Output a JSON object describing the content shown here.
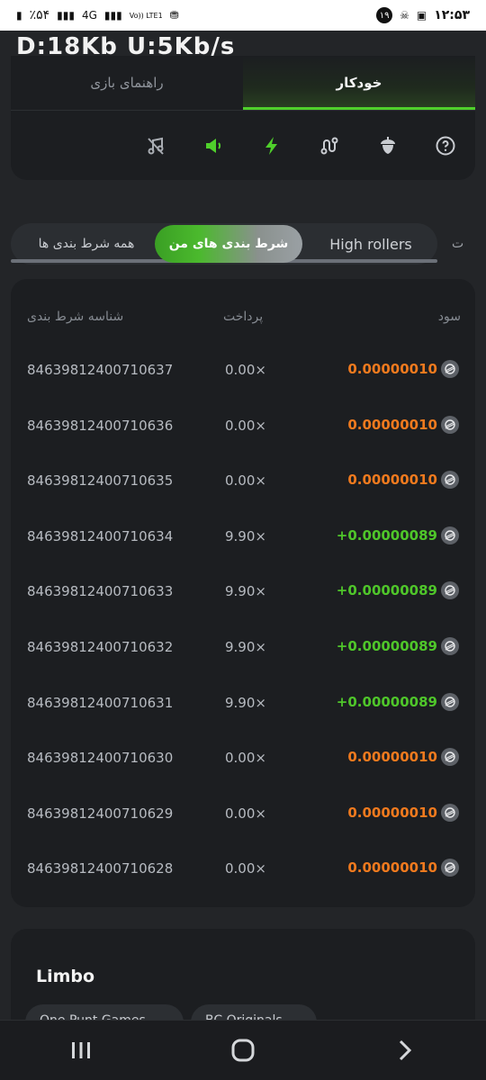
{
  "status_bar": {
    "battery": "٪۵۴",
    "network": "4G",
    "volte": "Vo)) LTE1",
    "notification_count": "۱۹",
    "time": "۱۲:۵۳"
  },
  "top_overlay_text": "D:18Kb  U:5Kb/s",
  "mode_tabs": {
    "guide_label": "راهنمای بازی",
    "auto_label": "خودکار"
  },
  "tool_icons": [
    "music-off-icon",
    "sound-icon",
    "lightning-icon",
    "route-icon",
    "acorn-icon",
    "help-icon"
  ],
  "accent_color": "#4fd02b",
  "bet_tabs": {
    "all_bets": "همه شرط بندی ها",
    "my_bets": "شرط بندی های من",
    "high_rollers": "High rollers",
    "cut_tab": "ت"
  },
  "table": {
    "headers": {
      "id": "شناسه شرط بندی",
      "payout": "پرداخت",
      "profit": "سود"
    },
    "rows": [
      {
        "id": "84639812400710637",
        "payout": "0.00×",
        "profit": "0.00000010",
        "status": "loss"
      },
      {
        "id": "84639812400710636",
        "payout": "0.00×",
        "profit": "0.00000010",
        "status": "loss"
      },
      {
        "id": "84639812400710635",
        "payout": "0.00×",
        "profit": "0.00000010",
        "status": "loss"
      },
      {
        "id": "84639812400710634",
        "payout": "9.90×",
        "profit": "+0.00000089",
        "status": "win"
      },
      {
        "id": "84639812400710633",
        "payout": "9.90×",
        "profit": "+0.00000089",
        "status": "win"
      },
      {
        "id": "84639812400710632",
        "payout": "9.90×",
        "profit": "+0.00000089",
        "status": "win"
      },
      {
        "id": "84639812400710631",
        "payout": "9.90×",
        "profit": "+0.00000089",
        "status": "win"
      },
      {
        "id": "84639812400710630",
        "payout": "0.00×",
        "profit": "0.00000010",
        "status": "loss"
      },
      {
        "id": "84639812400710629",
        "payout": "0.00×",
        "profit": "0.00000010",
        "status": "loss"
      },
      {
        "id": "84639812400710628",
        "payout": "0.00×",
        "profit": "0.00000010",
        "status": "loss"
      }
    ]
  },
  "limbo": {
    "title": "Limbo",
    "chips": [
      "One Punt Games",
      "BC Originals"
    ]
  },
  "navbar": [
    "recent-apps-icon",
    "home-icon",
    "back-icon"
  ]
}
